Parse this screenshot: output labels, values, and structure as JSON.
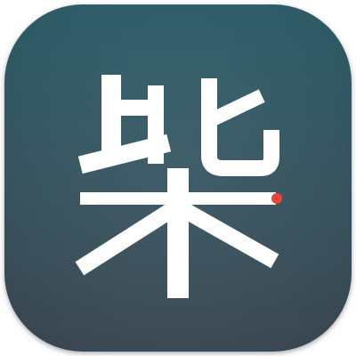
{
  "icon": {
    "glyph": "柴",
    "colors": {
      "background_top": "#2d5f6b",
      "background_bottom": "#3d4a55",
      "glyph": "#ffffff",
      "accent_dot": "#e8443a"
    }
  }
}
